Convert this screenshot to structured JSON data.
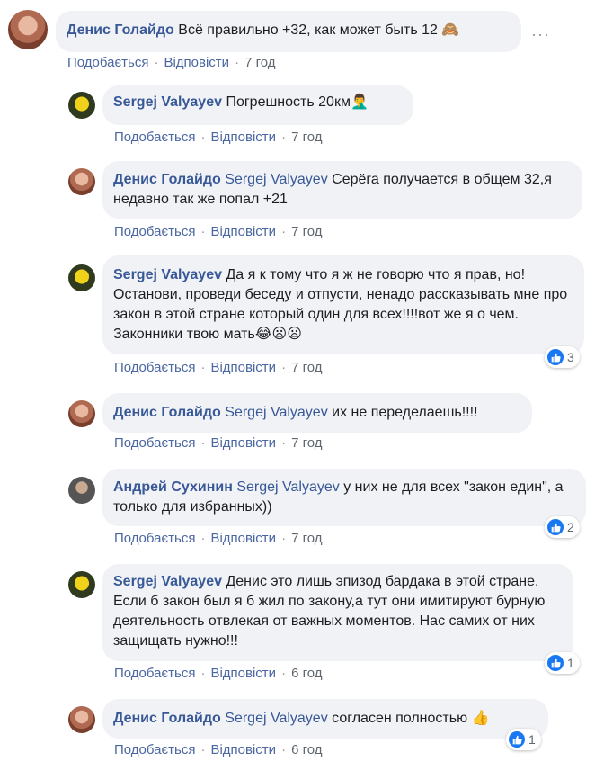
{
  "comments": [
    {
      "author": "Денис Голайдо",
      "mention": "",
      "text": "Всё правильно +32, как может быть 12",
      "emoji": "🙈",
      "like": "Подобається",
      "reply": "Відповісти",
      "time": "7 год",
      "reactions": ""
    },
    {
      "author": "Sergej Valyayev",
      "mention": "",
      "text": "Погрешность 20км",
      "emoji": "🤦‍♂️",
      "like": "Подобається",
      "reply": "Відповісти",
      "time": "7 год",
      "reactions": ""
    },
    {
      "author": "Денис Голайдо",
      "mention": "Sergej Valyayev",
      "text": "Серёга получается в общем 32,я недавно так же попал +21",
      "emoji": "",
      "like": "Подобається",
      "reply": "Відповісти",
      "time": "7 год",
      "reactions": ""
    },
    {
      "author": "Sergej Valyayev",
      "mention": "",
      "text": "Да я к тому что я ж не говорю что я прав, но! Останови, проведи беседу и отпусти, ненадо рассказывать мне про закон в этой стране который один для всех!!!!вот же я о чем. Законники твою мать",
      "emoji": "😂😦😦",
      "like": "Подобається",
      "reply": "Відповісти",
      "time": "7 год",
      "reactions": "3"
    },
    {
      "author": "Денис Голайдо",
      "mention": "Sergej Valyayev",
      "text": "их не переделаешь!!!!",
      "emoji": "",
      "like": "Подобається",
      "reply": "Відповісти",
      "time": "7 год",
      "reactions": ""
    },
    {
      "author": "Андрей Сухинин",
      "mention": "Sergej Valyayev",
      "text": "у них не для всех \"закон един\", а только для избранных))",
      "emoji": "",
      "like": "Подобається",
      "reply": "Відповісти",
      "time": "7 год",
      "reactions": "2"
    },
    {
      "author": "Sergej Valyayev",
      "mention": "",
      "text": "Денис это лишь эпизод бардака в этой стране. Если б закон был я б жил по закону,а тут они имитируют бурную деятельность отвлекая от важных моментов. Нас самих от них защищать нужно!!!",
      "emoji": "",
      "like": "Подобається",
      "reply": "Відповісти",
      "time": "6 год",
      "reactions": "1"
    },
    {
      "author": "Денис Голайдо",
      "mention": "Sergej Valyayev",
      "text": "согласен полностью",
      "emoji": "👍",
      "like": "Подобається",
      "reply": "Відповісти",
      "time": "6 год",
      "reactions": "1"
    }
  ],
  "more_label": "···",
  "colors": {
    "link": "#385898",
    "bubble": "#f0f2f5",
    "like_blue": "#1877f2",
    "meta": "#606770"
  },
  "icons": {
    "more": "more-options-icon",
    "reaction": "like-icon"
  }
}
